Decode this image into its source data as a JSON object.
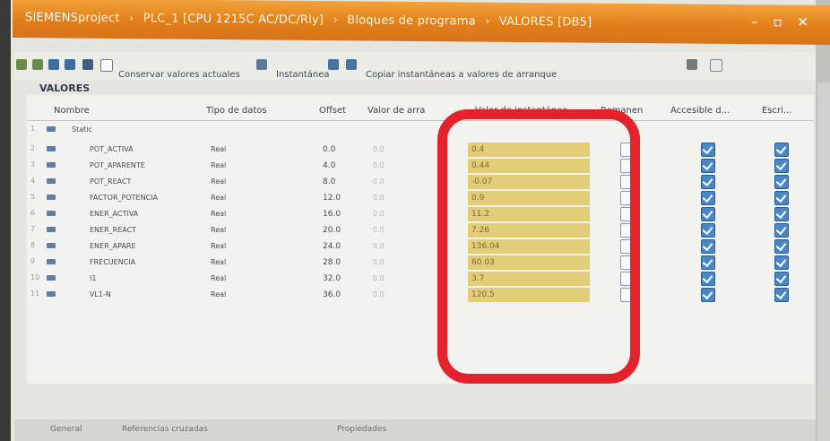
{
  "window": {
    "title_parts": [
      "SIEMENSproject",
      "PLC_1 [CPU 1215C AC/DC/Rly]",
      "Bloques de programa",
      "VALORES [DB5]"
    ],
    "separator": "›",
    "controls": "– ▫ ✕"
  },
  "toolbar": {
    "keep_values_label": "Conservar valores actuales",
    "snapshot_label": "Instantánea",
    "copy_snapshot_label": "Copiar instantáneas a valores de arranque"
  },
  "editor": {
    "title": "VALORES"
  },
  "table": {
    "columns": {
      "name": "Nombre",
      "data_type": "Tipo de datos",
      "offset": "Offset",
      "start_value": "Valor de arra",
      "snapshot": "Valor de instantánea",
      "retain": "Remanen",
      "accessible": "Accesible d...",
      "writable": "Escri..."
    },
    "static_row": {
      "num": "1",
      "label": "Static"
    },
    "rows": [
      {
        "num": "2",
        "name": "POT_ACTIVA",
        "type": "Real",
        "offset": "0.0",
        "start": "0.0",
        "snapshot": "0.4",
        "retain": false,
        "accessible": true,
        "writable": true
      },
      {
        "num": "3",
        "name": "POT_APARENTE",
        "type": "Real",
        "offset": "4.0",
        "start": "0.0",
        "snapshot": "0.44",
        "retain": false,
        "accessible": true,
        "writable": true
      },
      {
        "num": "4",
        "name": "POT_REACT",
        "type": "Real",
        "offset": "8.0",
        "start": "0.0",
        "snapshot": "-0.07",
        "retain": false,
        "accessible": true,
        "writable": true
      },
      {
        "num": "5",
        "name": "FACTOR_POTENCIA",
        "type": "Real",
        "offset": "12.0",
        "start": "0.0",
        "snapshot": "0.9",
        "retain": false,
        "accessible": true,
        "writable": true
      },
      {
        "num": "6",
        "name": "ENER_ACTIVA",
        "type": "Real",
        "offset": "16.0",
        "start": "0.0",
        "snapshot": "11.2",
        "retain": false,
        "accessible": true,
        "writable": true
      },
      {
        "num": "7",
        "name": "ENER_REACT",
        "type": "Real",
        "offset": "20.0",
        "start": "0.0",
        "snapshot": "7.26",
        "retain": false,
        "accessible": true,
        "writable": true
      },
      {
        "num": "8",
        "name": "ENER_APARE",
        "type": "Real",
        "offset": "24.0",
        "start": "0.0",
        "snapshot": "136.04",
        "retain": false,
        "accessible": true,
        "writable": true
      },
      {
        "num": "9",
        "name": "FRECUENCIA",
        "type": "Real",
        "offset": "28.0",
        "start": "0.0",
        "snapshot": "60.03",
        "retain": false,
        "accessible": true,
        "writable": true
      },
      {
        "num": "10",
        "name": "I1",
        "type": "Real",
        "offset": "32.0",
        "start": "0.0",
        "snapshot": "3.7",
        "retain": false,
        "accessible": true,
        "writable": true
      },
      {
        "num": "11",
        "name": "VL1-N",
        "type": "Real",
        "offset": "36.0",
        "start": "0.0",
        "snapshot": "120.5",
        "retain": false,
        "accessible": true,
        "writable": true
      }
    ]
  },
  "bottom": {
    "general_label": "General",
    "references_label": "Referencias cruzadas",
    "properties_label": "Propiedades"
  }
}
